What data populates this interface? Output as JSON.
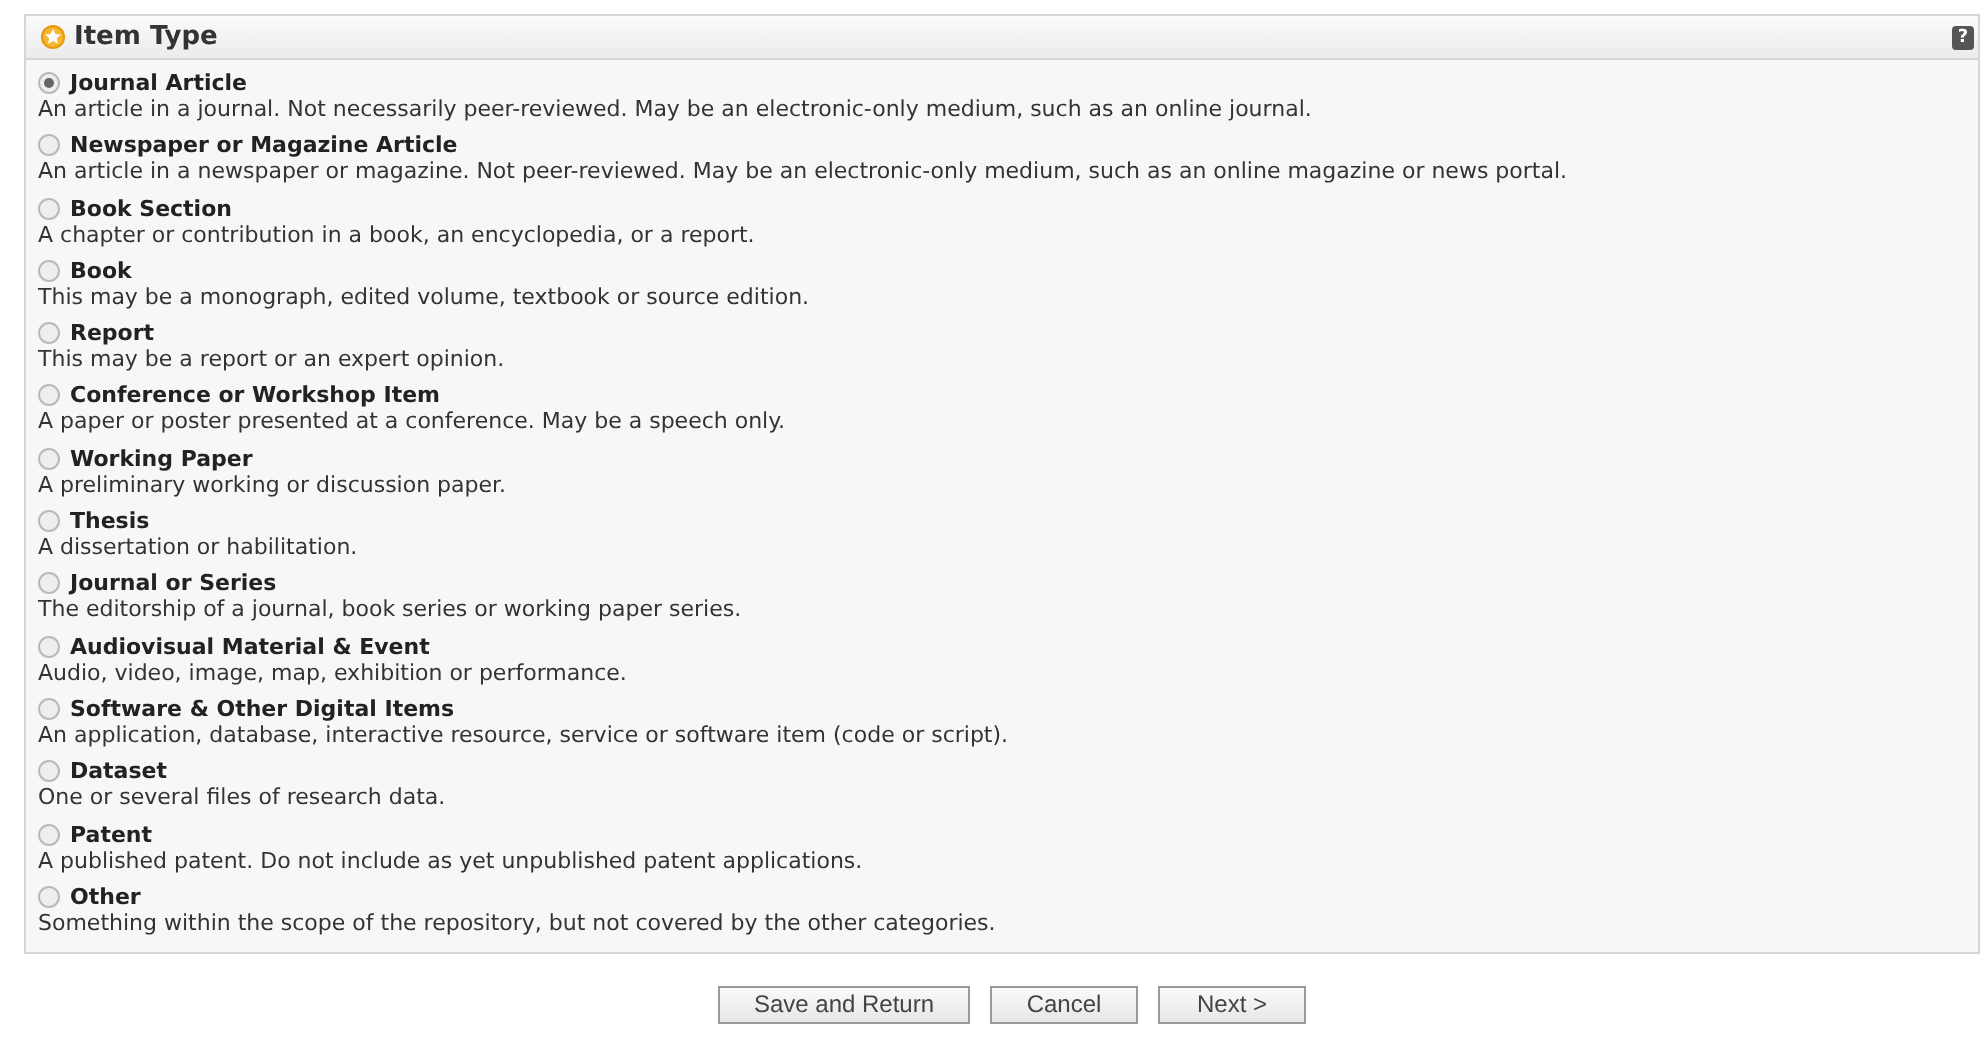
{
  "panel": {
    "title": "Item Type",
    "help": "?"
  },
  "options": [
    {
      "label": "Journal Article",
      "description": "An article in a journal. Not necessarily peer-reviewed. May be an electronic-only medium, such as an online journal.",
      "selected": true
    },
    {
      "label": "Newspaper or Magazine Article",
      "description": "An article in a newspaper or magazine. Not peer-reviewed. May be an electronic-only medium, such as an online magazine or news portal.",
      "selected": false
    },
    {
      "label": "Book Section",
      "description": "A chapter or contribution in a book, an encyclopedia, or a report.",
      "selected": false
    },
    {
      "label": "Book",
      "description": "This may be a monograph, edited volume, textbook or source edition.",
      "selected": false
    },
    {
      "label": "Report",
      "description": "This may be a report or an expert opinion.",
      "selected": false
    },
    {
      "label": "Conference or Workshop Item",
      "description": "A paper or poster presented at a conference. May be a speech only.",
      "selected": false
    },
    {
      "label": "Working Paper",
      "description": "A preliminary working or discussion paper.",
      "selected": false
    },
    {
      "label": "Thesis",
      "description": "A dissertation or habilitation.",
      "selected": false
    },
    {
      "label": "Journal or Series",
      "description": "The editorship of a journal, book series or working paper series.",
      "selected": false
    },
    {
      "label": "Audiovisual Material & Event",
      "description": "Audio, video, image, map, exhibition or performance.",
      "selected": false
    },
    {
      "label": "Software & Other Digital Items",
      "description": "An application, database, interactive resource, service or software item (code or script).",
      "selected": false
    },
    {
      "label": "Dataset",
      "description": "One or several files of research data.",
      "selected": false
    },
    {
      "label": "Patent",
      "description": "A published patent. Do not include as yet unpublished patent applications.",
      "selected": false
    },
    {
      "label": "Other",
      "description": "Something within the scope of the repository, but not covered by the other categories.",
      "selected": false
    }
  ],
  "buttons": [
    "Save and Return",
    "Cancel",
    "Next >"
  ]
}
